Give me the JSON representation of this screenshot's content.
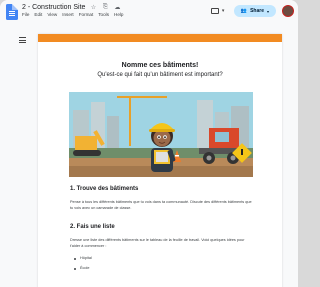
{
  "app": {
    "doc_title": "2 - Construction Site",
    "title_icons": [
      "star-icon",
      "move-icon",
      "cloud-icon"
    ],
    "menu": [
      "File",
      "Edit",
      "View",
      "Insert",
      "Format",
      "Tools",
      "Help"
    ],
    "share_label": "Share",
    "accent_color": "#c2e7ff"
  },
  "document": {
    "banner_color": "#f28b22",
    "heading": "Nomme ces bâtiments!",
    "subheading": "Qu'est-ce qui fait qu'un bâtiment est important?",
    "section1": {
      "title": "1. Trouve des bâtiments",
      "text": "Pense à tous les différents bâtiments que tu vois dans ta communauté. Discute des différents bâtiments que tu vois avec un camarade de classe."
    },
    "section2": {
      "title": "2. Fais une liste",
      "text": "Dresse une liste des différents bâtiments sur le tableau de la feuille de travail. Voici quelques idées pour t'aider à commencer :",
      "bullets": [
        "Hôpital",
        "École"
      ]
    }
  }
}
